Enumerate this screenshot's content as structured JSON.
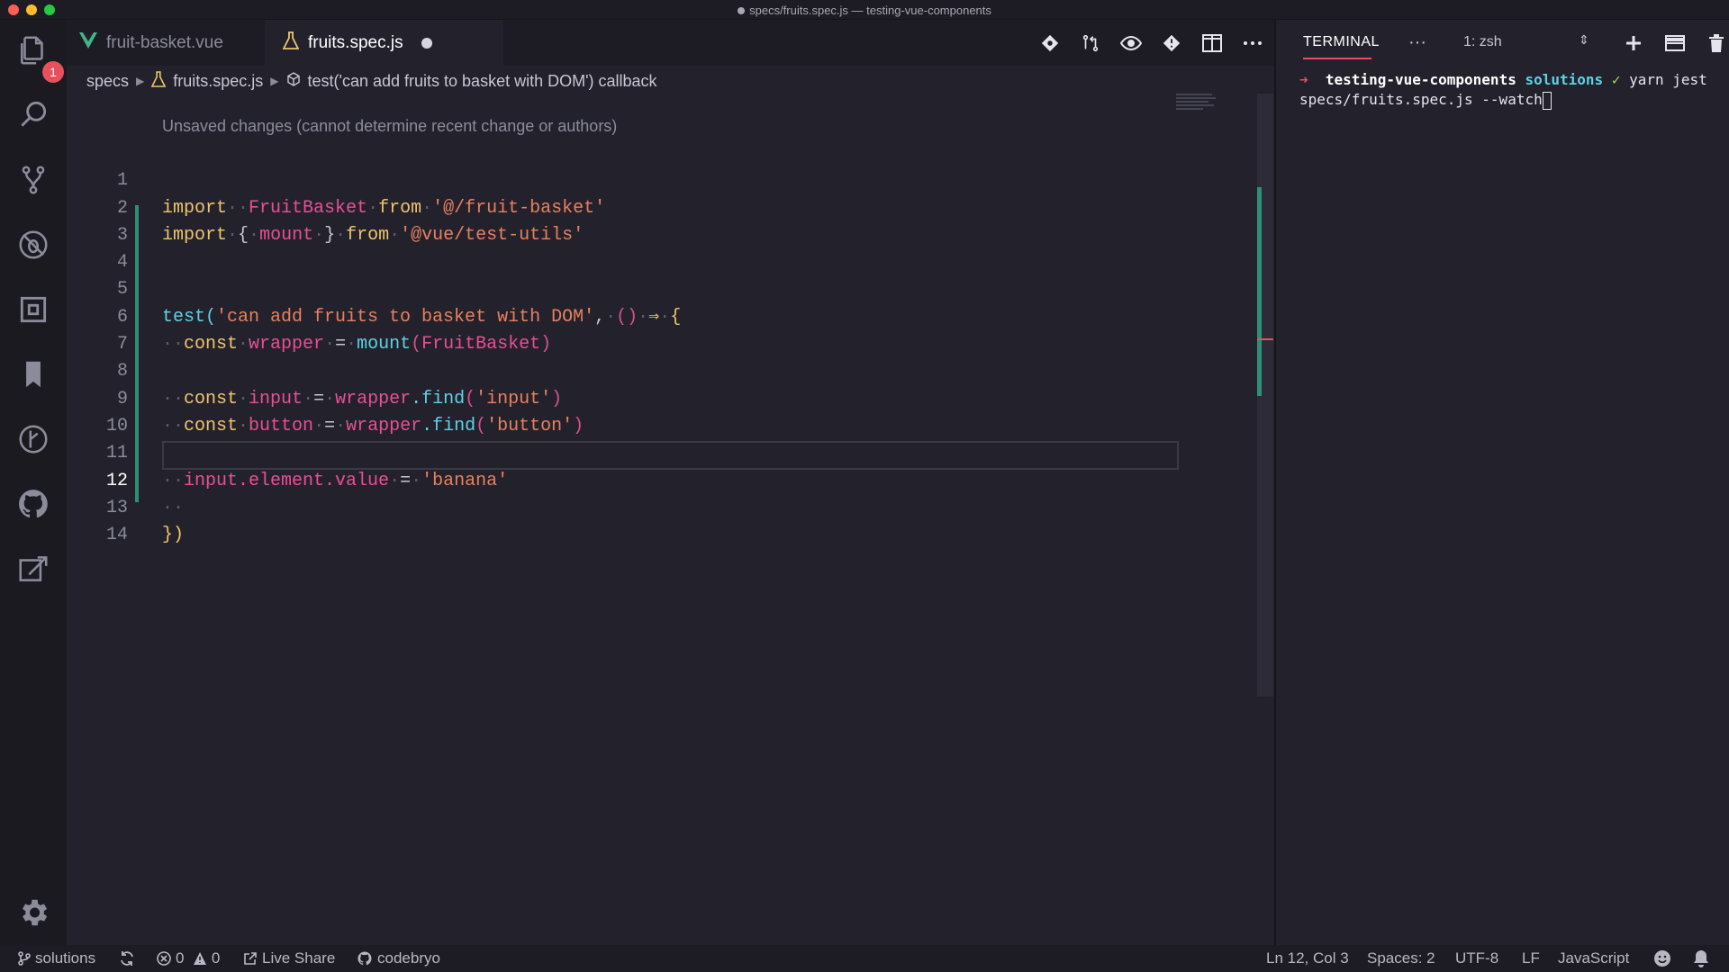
{
  "window": {
    "title": "specs/fruits.spec.js — testing-vue-components"
  },
  "activity_bar": {
    "explorer_badge": "1"
  },
  "tabs": [
    {
      "label": "fruit-basket.vue"
    },
    {
      "label": "fruits.spec.js"
    }
  ],
  "breadcrumb": {
    "folder": "specs",
    "file": "fruits.spec.js",
    "symbol": "test('can add fruits to basket with DOM') callback"
  },
  "codelens": "Unsaved changes (cannot determine recent change or authors)",
  "editor": {
    "active_line": "12",
    "line_numbers": [
      "1",
      "2",
      "3",
      "4",
      "5",
      "6",
      "7",
      "8",
      "9",
      "10",
      "11",
      "12",
      "13",
      "14"
    ],
    "tokens": {
      "l1": [
        "import",
        "FruitBasket",
        "from",
        "'@/fruit-basket'"
      ],
      "l2": [
        "import",
        "{",
        "mount",
        "}",
        "from",
        "'@vue/test-utils'"
      ],
      "l5": [
        "test(",
        "'can add fruits to basket with DOM'",
        ",",
        "()",
        "⇒",
        "{"
      ],
      "l6": [
        "const",
        "wrapper",
        "=",
        "mount",
        "(",
        "FruitBasket",
        ")"
      ],
      "l8": [
        "const",
        "input",
        "=",
        "wrapper",
        ".find",
        "(",
        "'input'",
        ")"
      ],
      "l9": [
        "const",
        "button",
        "=",
        "wrapper",
        ".find",
        "(",
        "'button'",
        ")"
      ],
      "l11": [
        "input",
        ".element",
        ".value",
        "=",
        "'banana'"
      ],
      "l13": [
        "}",
        ")"
      ]
    }
  },
  "terminal": {
    "tab_label": "TERMINAL",
    "more": "···",
    "shell_select": "1: zsh",
    "prompt_arrow": "➜",
    "directory": "testing-vue-components",
    "branch": "solutions",
    "check": "✓",
    "command_part1": "yarn jest",
    "command_part2": "specs/fruits.spec.js --watch"
  },
  "status_bar": {
    "branch": "solutions",
    "errors": "0",
    "warnings": "0",
    "live_share": "Live Share",
    "github_user": "codebryo",
    "position": "Ln 12, Col 3",
    "spaces": "Spaces: 2",
    "encoding": "UTF-8",
    "eol": "LF",
    "language": "JavaScript"
  },
  "colors": {
    "keyword": "#f0c46c",
    "string": "#e8805d",
    "function": "#5fd1e6",
    "variable": "#e84f95",
    "accent": "#e8505b",
    "git_added": "#2f8f74"
  }
}
